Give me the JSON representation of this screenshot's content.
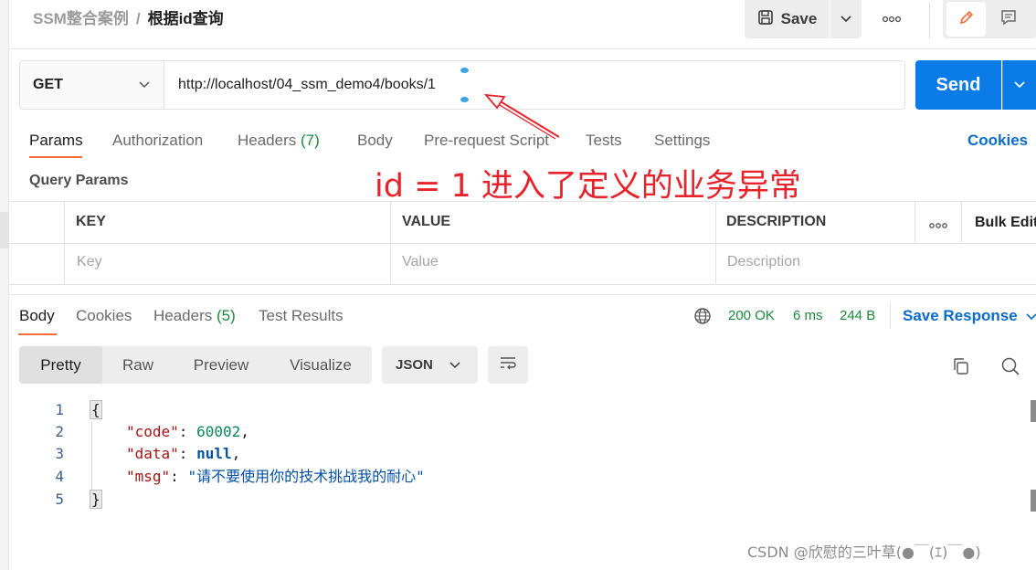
{
  "breadcrumb": {
    "collection": "SSM整合案例",
    "separator": "/",
    "request": "根据id查询"
  },
  "toolbar": {
    "save_label": "Save",
    "more_icon": "more-horizontal-icon"
  },
  "request": {
    "method": "GET",
    "url": "http://localhost/04_ssm_demo4/books/1",
    "send_label": "Send"
  },
  "request_tabs": {
    "params": "Params",
    "authorization": "Authorization",
    "headers": "Headers",
    "headers_count": "(7)",
    "body": "Body",
    "prerequest": "Pre-request Script",
    "tests": "Tests",
    "settings": "Settings",
    "cookies": "Cookies"
  },
  "query_params": {
    "title": "Query Params",
    "columns": [
      "KEY",
      "VALUE",
      "DESCRIPTION"
    ],
    "bulk_edit": "Bulk Edit",
    "placeholders": {
      "key": "Key",
      "value": "Value",
      "description": "Description"
    }
  },
  "annotation": {
    "text": "id = 1 进入了定义的业务异常",
    "color": "#e8232c"
  },
  "response_tabs": {
    "body": "Body",
    "cookies": "Cookies",
    "headers": "Headers",
    "headers_count": "(5)",
    "test_results": "Test Results"
  },
  "response_status": {
    "status": "200 OK",
    "time": "6 ms",
    "size": "244 B",
    "save_response": "Save Response"
  },
  "view_modes": {
    "pretty": "Pretty",
    "raw": "Raw",
    "preview": "Preview",
    "visualize": "Visualize",
    "format": "JSON"
  },
  "code": {
    "line_numbers": [
      "1",
      "2",
      "3",
      "4",
      "5"
    ],
    "open_brace": "{",
    "close_brace": "}",
    "lines": [
      {
        "key": "\"code\"",
        "value": "60002",
        "trail": ","
      },
      {
        "key": "\"data\"",
        "value": "null",
        "trail": ","
      },
      {
        "key": "\"msg\"",
        "value": "\"请不要使用你的技术挑战我的耐心\"",
        "trail": ""
      }
    ]
  },
  "watermark": "CSDN @欣慰的三叶草(●￣(ｴ)￣●)",
  "colors": {
    "accent": "#f26b3a",
    "primary": "#0b7be8",
    "link": "#0b6bcb",
    "success": "#1a8a3a"
  }
}
